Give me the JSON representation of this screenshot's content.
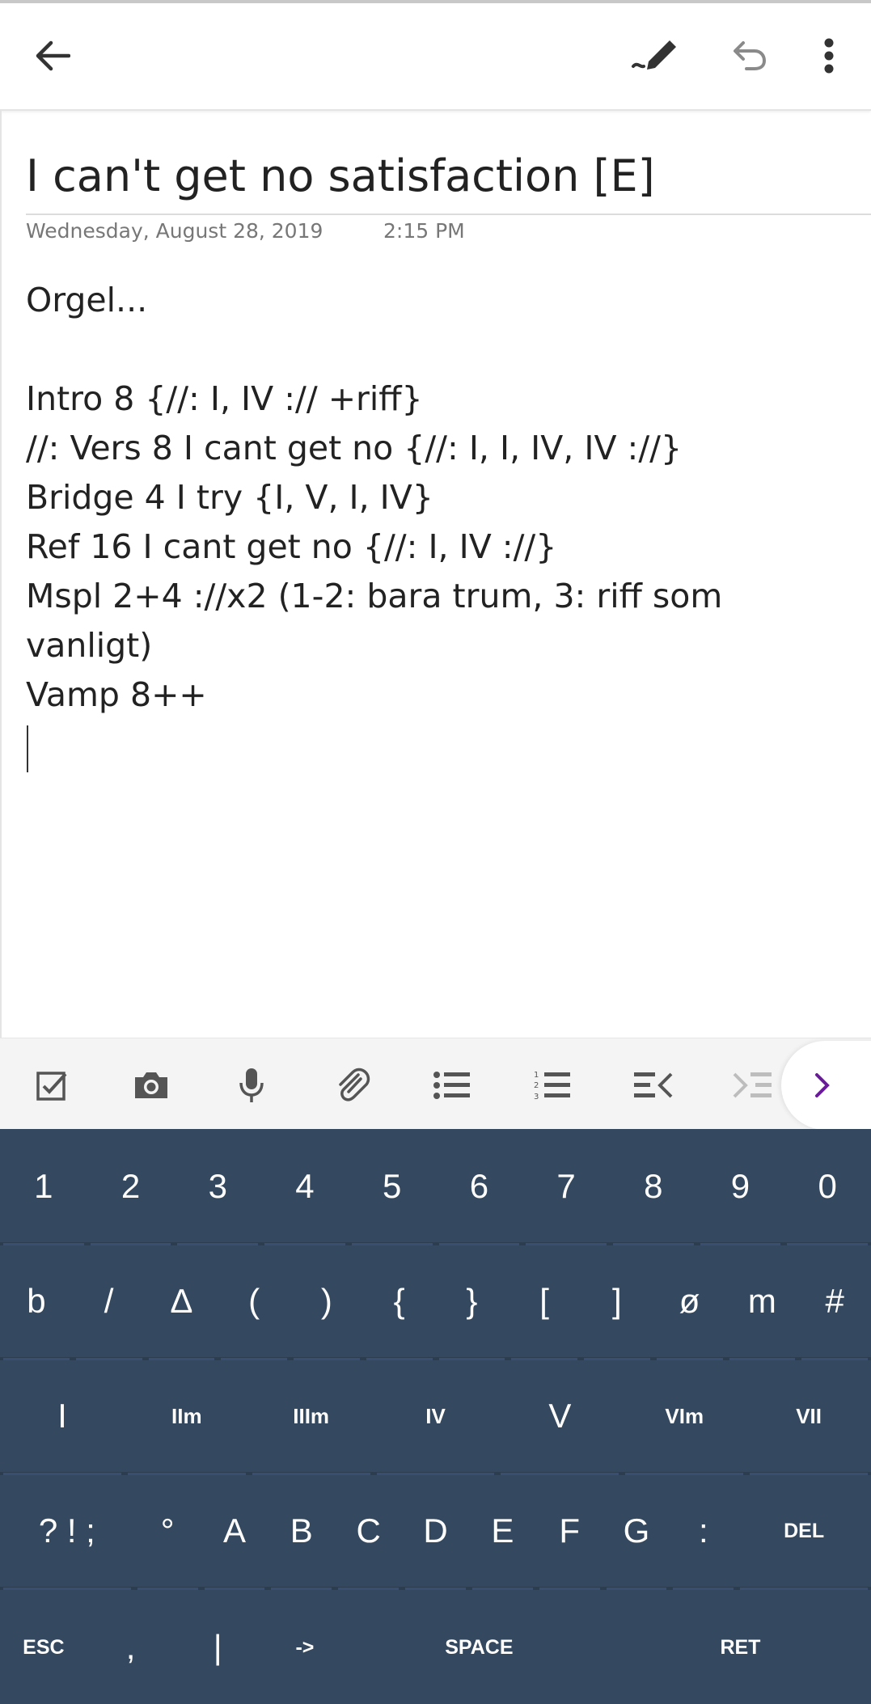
{
  "toolbar": {
    "back_icon": "arrow-left-icon",
    "pen_icon": "pen-icon",
    "undo_icon": "undo-icon",
    "more_icon": "more-vertical-icon"
  },
  "note": {
    "title": "I can't get no satisfaction [E]",
    "date": "Wednesday, August 28, 2019",
    "time": "2:15 PM",
    "lines": [
      "Orgel...",
      "",
      "Intro 8 {//: I, IV :// +riff}",
      "//: Vers 8 I cant get no {//: I, I, IV, IV ://}",
      "Bridge 4 I try {I, V, I, IV}",
      "Ref 16 I cant get no {//: I, IV ://}",
      "Mspl 2+4 ://x2 (1-2: bara trum, 3: riff som",
      "vanligt)",
      "Vamp 8++"
    ]
  },
  "format_toolbar": {
    "tools": [
      "checkbox-icon",
      "camera-icon",
      "microphone-icon",
      "paperclip-icon",
      "bullet-list-icon",
      "numbered-list-icon",
      "outdent-icon",
      "indent-icon"
    ],
    "more_icon": "chevron-right-icon",
    "accent": "#6a1b9a"
  },
  "keyboard": {
    "background": "#34495f",
    "row1": [
      "1",
      "2",
      "3",
      "4",
      "5",
      "6",
      "7",
      "8",
      "9",
      "0"
    ],
    "row2": [
      "b",
      "/",
      "Δ",
      "(",
      ")",
      "{",
      "}",
      "[",
      "]",
      "ø",
      "m",
      "#"
    ],
    "row3": [
      "I",
      "IIm",
      "IIIm",
      "IV",
      "V",
      "VIm",
      "VII"
    ],
    "row4": [
      "? ! ;",
      "°",
      "A",
      "B",
      "C",
      "D",
      "E",
      "F",
      "G",
      ":",
      "DEL"
    ],
    "row5": [
      "ESC",
      ",",
      "|",
      "->",
      "SPACE",
      "RET"
    ]
  }
}
